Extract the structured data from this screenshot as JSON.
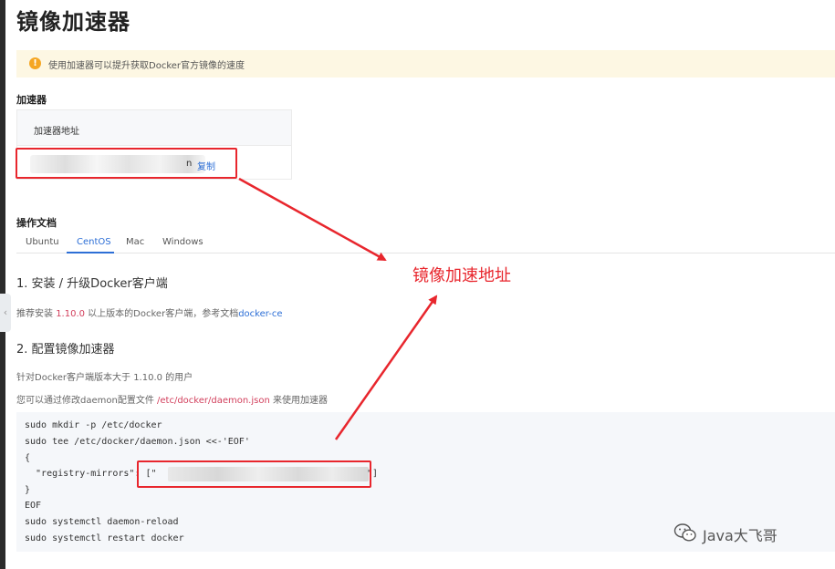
{
  "page": {
    "title": "镜像加速器"
  },
  "notice": {
    "icon": "warning-icon",
    "text": "使用加速器可以提升获取Docker官方镜像的速度"
  },
  "accelerator": {
    "section_title": "加速器",
    "column_header": "加速器地址",
    "address_visible_tail": "n",
    "copy_label": "复制"
  },
  "docs": {
    "section_title": "操作文档",
    "tabs": [
      {
        "label": "Ubuntu",
        "active": false
      },
      {
        "label": "CentOS",
        "active": true
      },
      {
        "label": "Mac",
        "active": false
      },
      {
        "label": "Windows",
        "active": false
      }
    ],
    "step1_title": "1. 安装 / 升级Docker客户端",
    "step1_text_before": "推荐安装 ",
    "step1_version": "1.10.0",
    "step1_text_middle": " 以上版本的Docker客户端，参考文档",
    "step1_link": "docker-ce",
    "step2_title": "2. 配置镜像加速器",
    "step2_text1": "针对Docker客户端版本大于 1.10.0 的用户",
    "step2_text2_before": "您可以通过修改daemon配置文件 ",
    "step2_path": "/etc/docker/daemon.json",
    "step2_text2_after": " 来使用加速器"
  },
  "code": {
    "lines": [
      "sudo mkdir -p /etc/docker",
      "sudo tee /etc/docker/daemon.json <<-'EOF'",
      "{",
      "  \"registry-mirrors\": [\"",
      "}",
      "EOF",
      "sudo systemctl daemon-reload",
      "sudo systemctl restart docker"
    ],
    "mirror_tail": "\"]"
  },
  "annotation": {
    "label": "镜像加速地址",
    "color": "#e8262d"
  },
  "watermark": {
    "text": "Java大飞哥",
    "icon": "wechat-icon"
  },
  "colors": {
    "accent": "#2d6fd6",
    "highlight": "#d23f5c",
    "notice_bg": "#fdf7e3",
    "warning": "#f5a623"
  }
}
